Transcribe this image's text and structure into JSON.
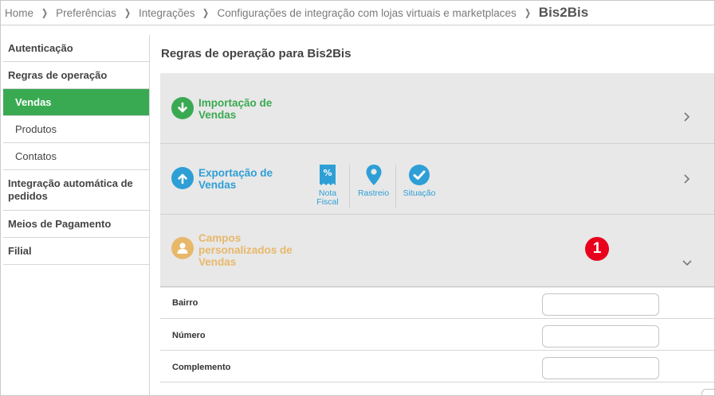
{
  "breadcrumb": {
    "items": [
      "Home",
      "Preferências",
      "Integrações",
      "Configurações de integração com lojas virtuais e marketplaces"
    ],
    "current": "Bis2Bis"
  },
  "sidebar": {
    "items": [
      {
        "label": "Autenticação"
      },
      {
        "label": "Regras de operação"
      },
      {
        "label": "Vendas"
      },
      {
        "label": "Produtos"
      },
      {
        "label": "Contatos"
      },
      {
        "label": "Integração automática de pedidos"
      },
      {
        "label": "Meios de Pagamento"
      },
      {
        "label": "Filial"
      }
    ]
  },
  "main": {
    "title": "Regras de operação para Bis2Bis",
    "sections": [
      {
        "label": "Importação de Vendas",
        "color": "#3aaa52",
        "icon": "arrow-down-icon"
      },
      {
        "label": "Exportação de Vendas",
        "color": "#2e9fd6",
        "icon": "arrow-up-icon",
        "shortcuts": [
          {
            "label": "Nota Fiscal",
            "icon": "invoice-percent-icon"
          },
          {
            "label": "Rastreio",
            "icon": "map-pin-icon"
          },
          {
            "label": "Situação",
            "icon": "check-circle-icon"
          }
        ]
      },
      {
        "label": "Campos personalizados de Vendas",
        "color": "#e8b86a",
        "icon": "user-icon"
      }
    ],
    "step_badge": "1",
    "fields": [
      {
        "label": "Bairro",
        "value": ""
      },
      {
        "label": "Número",
        "value": ""
      },
      {
        "label": "Complemento",
        "value": ""
      }
    ]
  }
}
